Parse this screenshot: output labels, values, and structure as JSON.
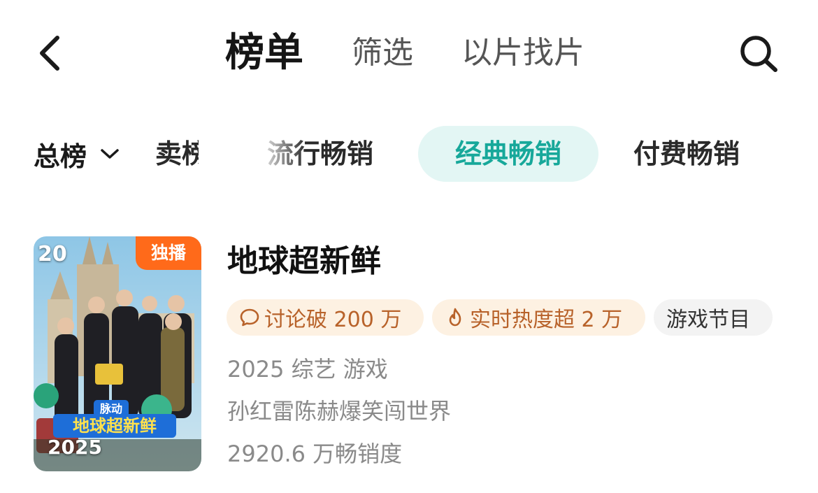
{
  "header": {
    "tabs": [
      {
        "label": "榜单",
        "active": true
      },
      {
        "label": "筛选",
        "active": false
      },
      {
        "label": "以片找片",
        "active": false
      }
    ],
    "icons": {
      "back": "chevron-left-icon",
      "search": "search-icon"
    }
  },
  "filters": {
    "rank_type": "总榜",
    "sub_tabs": [
      {
        "label": "热卖榜",
        "active": false
      },
      {
        "label": "流行畅销",
        "active": false
      },
      {
        "label": "经典畅销",
        "active": true
      },
      {
        "label": "付费畅销",
        "active": false
      }
    ],
    "active_color": "#17a89a",
    "active_bg": "#e3f6f4"
  },
  "item": {
    "rank": "20",
    "badge": "独播",
    "poster_year": "2025",
    "title": "地球超新鲜",
    "tags": [
      {
        "icon": "comment-icon",
        "text": "讨论破 200 万"
      },
      {
        "icon": "flame-icon",
        "text": "实时热度超 2 万"
      },
      {
        "icon": "",
        "text": "游戏节目"
      }
    ],
    "meta": "2025 综艺 游戏",
    "description": "孙红雷陈赫爆笑闯世界",
    "sales": "2920.6 万畅销度",
    "poster_logo": "地球超新鲜",
    "poster_logo_sub": "脉动"
  },
  "colors": {
    "badge": "#ff6a1a",
    "tag_orange_text": "#b8622a",
    "tag_orange_bg": "#fdf1e2"
  }
}
